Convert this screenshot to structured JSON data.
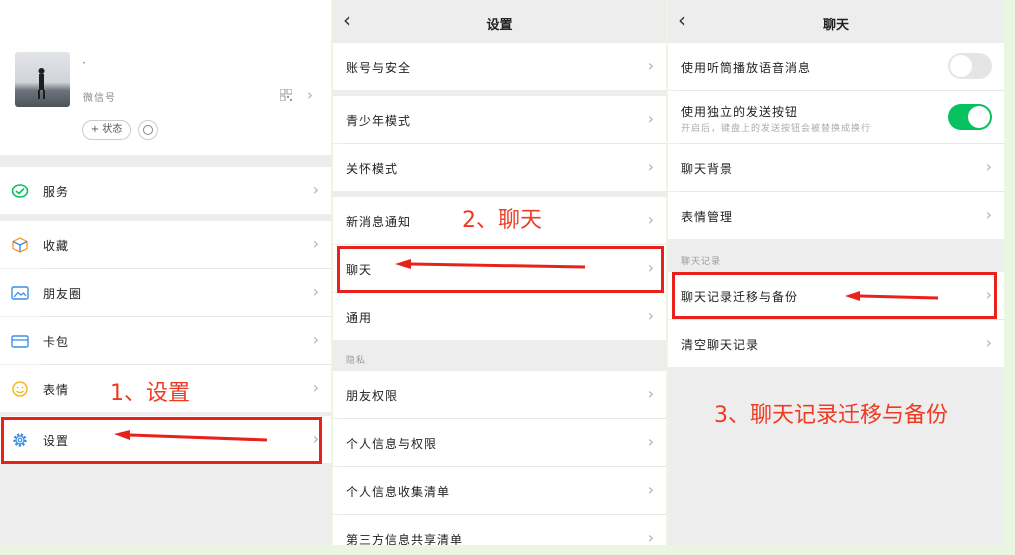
{
  "panel_me": {
    "profile": {
      "name": "·",
      "wechat_id_label": "微信号",
      "status_button": "+ 状态"
    },
    "items": [
      {
        "label": "服务",
        "icon": "service-icon"
      },
      {
        "label": "收藏",
        "icon": "favorites-icon"
      },
      {
        "label": "朋友圈",
        "icon": "moments-icon"
      },
      {
        "label": "卡包",
        "icon": "cards-icon"
      },
      {
        "label": "表情",
        "icon": "sticker-icon"
      },
      {
        "label": "设置",
        "icon": "gear-icon"
      }
    ]
  },
  "panel_settings": {
    "title": "设置",
    "items": [
      {
        "label": "账号与安全"
      },
      {
        "label": "青少年模式"
      },
      {
        "label": "关怀模式"
      },
      {
        "label": "新消息通知"
      },
      {
        "label": "聊天"
      },
      {
        "label": "通用"
      }
    ],
    "privacy_section": "隐私",
    "privacy_items": [
      {
        "label": "朋友权限"
      },
      {
        "label": "个人信息与权限"
      },
      {
        "label": "个人信息收集清单"
      },
      {
        "label": "第三方信息共享清单"
      }
    ]
  },
  "panel_chat": {
    "title": "聊天",
    "items": [
      {
        "label": "使用听筒播放语音消息",
        "toggle": "off"
      },
      {
        "label": "使用独立的发送按钮",
        "subtitle": "开启后，键盘上的发送按钮会被替换成换行",
        "toggle": "on"
      },
      {
        "label": "聊天背景"
      },
      {
        "label": "表情管理"
      }
    ],
    "history_section": "聊天记录",
    "history_items": [
      {
        "label": "聊天记录迁移与备份"
      },
      {
        "label": "清空聊天记录"
      }
    ]
  },
  "annotations": {
    "step1": "1、设置",
    "step2": "2、聊天",
    "step3": "3、聊天记录迁移与备份"
  },
  "colors": {
    "highlight": "#e8221b",
    "annotation": "#ee3a23",
    "toggle_on": "#07c160",
    "wechat_green": "#07c160"
  }
}
